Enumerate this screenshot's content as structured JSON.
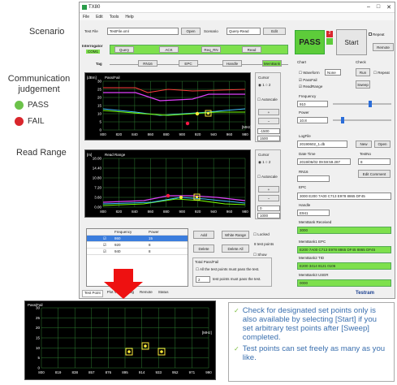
{
  "side_labels": {
    "scenario": "Scenario",
    "communication": "Communication judgement",
    "pass": "PASS",
    "fail": "FAIL",
    "read_range": "Read Range"
  },
  "colors": {
    "pass": "#6cc24a",
    "fail": "#d9262c",
    "green_field": "#7ee04d",
    "accent_red": "#e11"
  },
  "window": {
    "title": "TX80",
    "menu": [
      "File",
      "Edit",
      "Tools",
      "Help"
    ],
    "test_file_label": "Test File",
    "test_file_value": "TestFile.xml",
    "open_label": "Open",
    "scenario_label": "Scenario",
    "scenario_value": "Query-Read",
    "edit_label": "Edit",
    "interrogator_label": "Interrogator",
    "com_label": "COM1",
    "seq": [
      "Query",
      "ACK",
      "Req_RN",
      "Read"
    ],
    "tag_label": "Tag",
    "tag_seq": [
      "RN16",
      "EPC",
      "Handle",
      "MemBank"
    ],
    "pass_label": "PASS",
    "counter": "2",
    "start_label": "Start",
    "repeat_label": "Repeat",
    "remote_label": "Remote"
  },
  "chart1": {
    "title": "Pass/Fail",
    "unit": "[dBm]",
    "xunit": "[MHz]",
    "yticks": [
      "30",
      "25",
      "20",
      "15",
      "10",
      "5",
      "0"
    ],
    "xticks": [
      "800",
      "820",
      "840",
      "860",
      "880",
      "900",
      "920",
      "940",
      "960",
      "980"
    ]
  },
  "chart2": {
    "title": "Read Range",
    "unit": "[m]",
    "xunit": "[MHz]",
    "yticks": [
      "18.00",
      "14.40",
      "10.80",
      "7.20",
      "3.60",
      "0.00"
    ],
    "xticks": [
      "800",
      "820",
      "840",
      "860",
      "880",
      "900",
      "920",
      "940",
      "960",
      "980"
    ]
  },
  "cursor": {
    "label": "Cursor",
    "radio": "1",
    "autoscale": "Autoscale",
    "plus": "+",
    "minus": "−",
    "val1": "-1500",
    "val2": "1500",
    "val3": "0",
    "val4": "1000"
  },
  "table": {
    "headers": [
      "Frequency",
      "Power"
    ],
    "rows": [
      {
        "freq": "860",
        "power": "15"
      },
      {
        "freq": "920",
        "power": "8"
      },
      {
        "freq": "940",
        "power": "8"
      }
    ]
  },
  "table_buttons": {
    "add": "Add",
    "white_range": "White Range",
    "delete": "Delete",
    "delete_all": "Delete All",
    "locked": "Locked",
    "test_points": "8 test points",
    "show": "Show"
  },
  "total_pass": {
    "title": "Total Pass/Fail",
    "all_label": "All the test points must pass the test.",
    "num": "2",
    "num_label": "test points must pass the test."
  },
  "tabs": [
    "Test Point",
    "Plot View",
    "Log",
    "Remote",
    "Status"
  ],
  "right": {
    "chart_label": "Chart",
    "waveform": "Waveform",
    "waveform_val": "None",
    "pass_fail": "PassFail",
    "read_range": "ReadRange",
    "check_label": "Check",
    "run": "Run",
    "repeat": "Repeat",
    "sweep": "Sweep",
    "frequency_label": "Frequency",
    "frequency_val": "910",
    "power_label": "Power",
    "power_val": "10.8",
    "logfile_label": "LogFile",
    "logfile_val": "20190602_1.db",
    "new": "New",
    "open": "Open",
    "datetime_label": "Date Time",
    "datetime_val": "2019/06/02 09:59:59.287",
    "testno_label": "TestNo",
    "testno_val": "8",
    "rn16_label": "RN16",
    "rn16_val": "",
    "edit_comment": "Edit Comment",
    "epc_label": "EPC",
    "epc_val": "3000 E200 7A00 C713 E978 8865 DF45",
    "handle_label": "Handle",
    "handle_val": "E941",
    "mb_received_label": "MemBank Received",
    "mb_received_val": "3000",
    "mb_epc_label": "MemBank1 EPC",
    "mb_epc_val": "E200 7A00 C713 E978 8865 DF45 8865 DF45",
    "mb_tid_label": "MemBank2 TID",
    "mb_tid_val": "E200 3414 8121 0106",
    "mb_user_label": "MemBank3 USER",
    "mb_user_val": "0000",
    "brand": "Testram"
  },
  "zoom": {
    "title": "Pass/Fail",
    "xunit": "[MHz]",
    "yticks": [
      "30",
      "25",
      "20",
      "15",
      "10",
      "5",
      "0"
    ],
    "xticks": [
      "800",
      "819",
      "838",
      "857",
      "876",
      "895",
      "914",
      "933",
      "952",
      "971",
      "990"
    ]
  },
  "notes": [
    "Check for designated set points only is also available by selecting [Start] if you set arbitrary test points after [Sweep] completed.",
    "Test points can set freely as many as you like."
  ]
}
